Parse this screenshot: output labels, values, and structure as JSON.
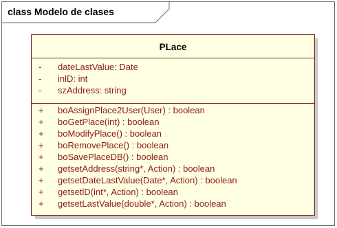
{
  "frame": {
    "title": "class Modelo de clases"
  },
  "class": {
    "name": "PLace",
    "attributes": [
      {
        "visibility": "-",
        "text": "dateLastValue:  Date"
      },
      {
        "visibility": "-",
        "text": "inlD:  int"
      },
      {
        "visibility": "-",
        "text": "szAddress:  string"
      }
    ],
    "operations": [
      {
        "visibility": "+",
        "text": "boAssignPlace2User(User) : boolean"
      },
      {
        "visibility": "+",
        "text": "boGetPlace(int) : boolean"
      },
      {
        "visibility": "+",
        "text": "boModifyPlace() : boolean"
      },
      {
        "visibility": "+",
        "text": "boRemovePlace() : boolean"
      },
      {
        "visibility": "+",
        "text": "boSavePlaceDB() : boolean"
      },
      {
        "visibility": "+",
        "text": "getsetAddress(string*, Action) : boolean"
      },
      {
        "visibility": "+",
        "text": "getsetDateLastValue(Date*, Action) : boolean"
      },
      {
        "visibility": "+",
        "text": "getsetlD(int*, Action) : boolean"
      },
      {
        "visibility": "+",
        "text": "getsetLastValue(double*, Action) : boolean"
      }
    ]
  },
  "colors": {
    "class_fill": "#ffffe1",
    "class_border": "#7a1e1e",
    "member_text": "#8b1a1a",
    "shadow": "#c8c8c8"
  }
}
